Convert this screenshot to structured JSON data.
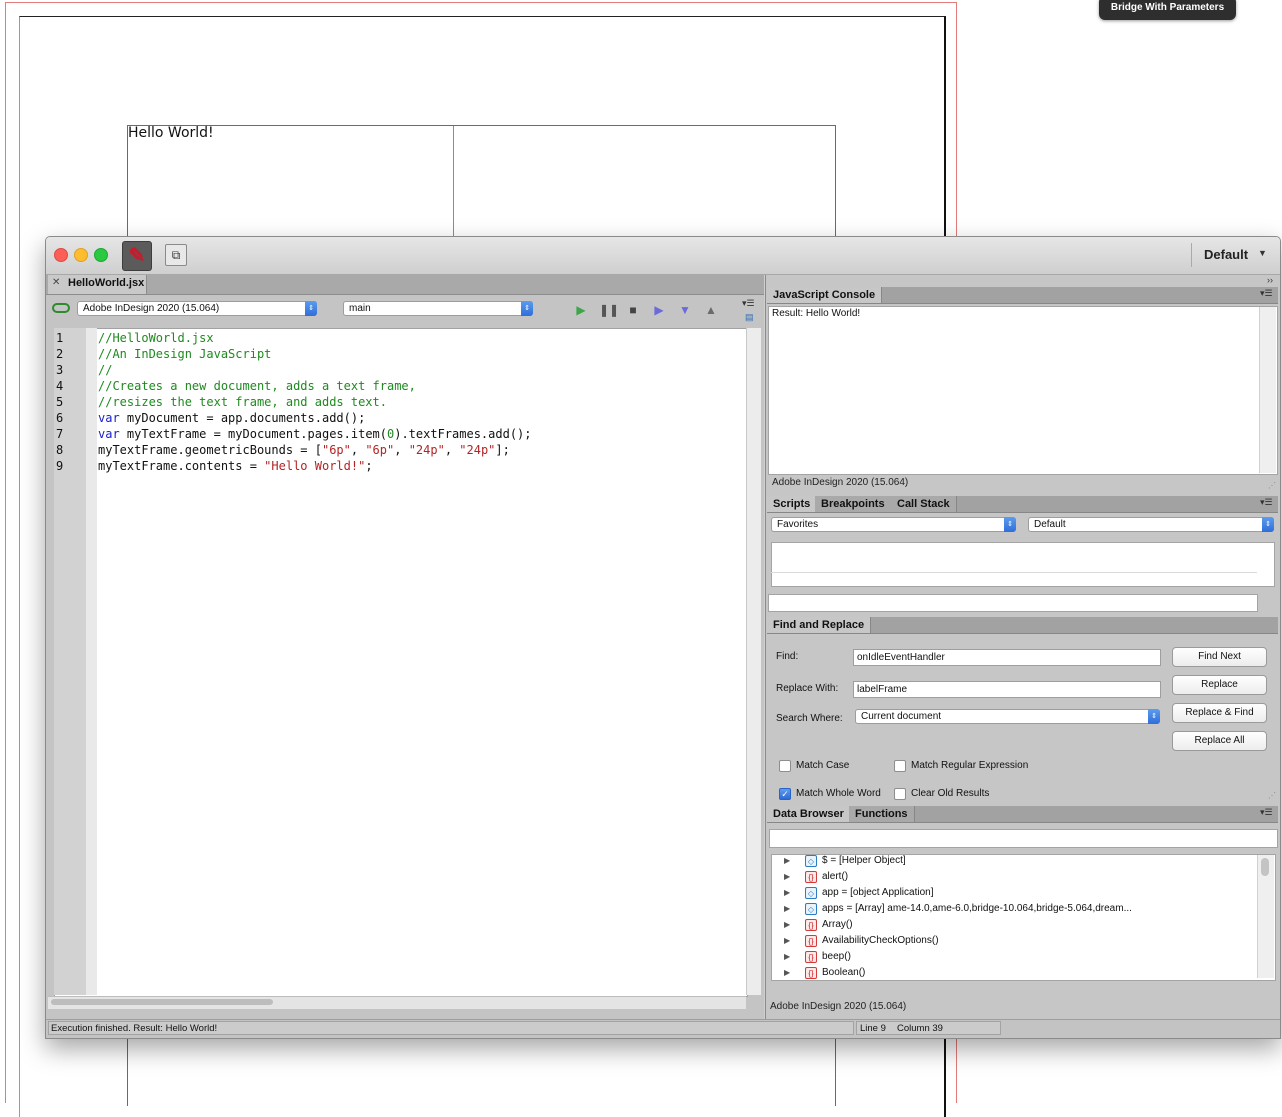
{
  "canvas": {
    "text_frame_content": "Hello World!",
    "tooltip": "Bridge With Parameters"
  },
  "window": {
    "workspace": "Default",
    "icons": [
      "estk-logo-icon",
      "window-layout-icon"
    ]
  },
  "editor": {
    "tab_title": "HelloWorld.jsx",
    "target_app": "Adobe InDesign 2020 (15.064)",
    "engine": "main",
    "line_numbers": [
      "1",
      "2",
      "3",
      "4",
      "5",
      "6",
      "7",
      "8",
      "9"
    ],
    "code_lines": [
      "//HelloWorld.jsx",
      "//An InDesign JavaScript",
      "//",
      "//Creates a new document, adds a text frame,",
      "//resizes the text frame, and adds text.",
      "var myDocument = app.documents.add();",
      "var myTextFrame = myDocument.pages.item(0).textFrames.add();",
      "myTextFrame.geometricBounds = [\"6p\", \"6p\", \"24p\", \"24p\"];",
      "myTextFrame.contents = \"Hello World!\";"
    ]
  },
  "console": {
    "tab": "JavaScript Console",
    "output": "Result: Hello World!",
    "footer": "Adobe InDesign 2020 (15.064)"
  },
  "scripts_panel": {
    "tabs": [
      "Scripts",
      "Breakpoints",
      "Call Stack"
    ],
    "left_select": "Favorites",
    "right_select": "Default"
  },
  "find_replace": {
    "tab": "Find and Replace",
    "find_label": "Find:",
    "find_value": "onIdleEventHandler",
    "replace_label": "Replace With:",
    "replace_value": "labelFrame",
    "search_where_label": "Search Where:",
    "search_where_value": "Current document",
    "buttons": [
      "Find Next",
      "Replace",
      "Replace & Find",
      "Replace All"
    ],
    "options": [
      {
        "label": "Match Case",
        "checked": false
      },
      {
        "label": "Match Regular Expression",
        "checked": false
      },
      {
        "label": "Match Whole Word",
        "checked": true
      },
      {
        "label": "Clear Old Results",
        "checked": false
      }
    ]
  },
  "data_browser": {
    "tabs": [
      "Data Browser",
      "Functions"
    ],
    "items": [
      {
        "text": "$ = [Helper Object]",
        "kind": "object"
      },
      {
        "text": "alert()",
        "kind": "function"
      },
      {
        "text": "app = [object Application]",
        "kind": "object"
      },
      {
        "text": "apps = [Array] ame-14.0,ame-6.0,bridge-10.064,bridge-5.064,dream...",
        "kind": "object"
      },
      {
        "text": "Array()",
        "kind": "function"
      },
      {
        "text": "AvailabilityCheckOptions()",
        "kind": "function"
      },
      {
        "text": "beep()",
        "kind": "function"
      },
      {
        "text": "Boolean()",
        "kind": "function"
      }
    ],
    "footer": "Adobe InDesign 2020 (15.064)"
  },
  "status": {
    "message": "Execution finished. Result: Hello World!",
    "line": "Line 9",
    "column": "Column 39"
  }
}
